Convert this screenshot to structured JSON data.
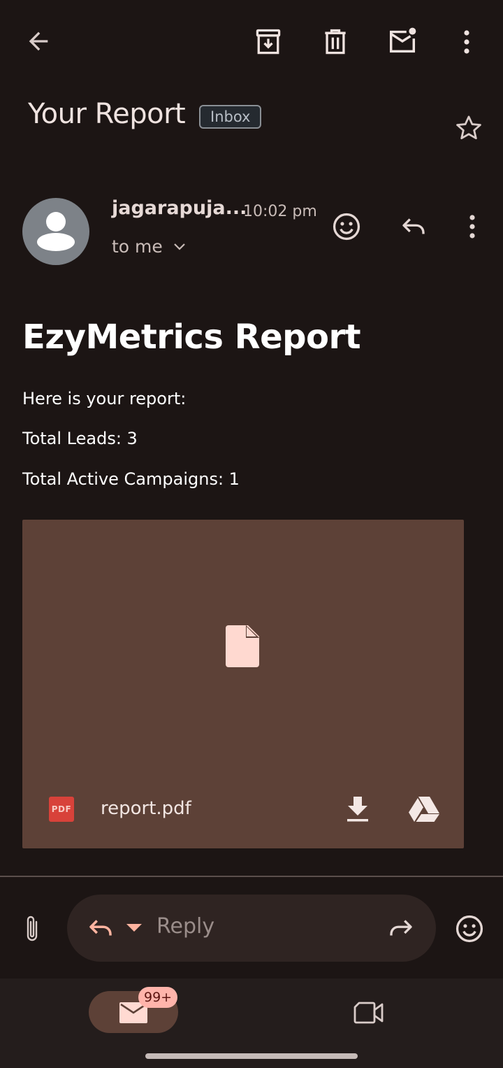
{
  "header": {
    "subject": "Your Report",
    "label_chip": "Inbox"
  },
  "sender": {
    "name": "jagarapuja...",
    "time": "10:02 pm",
    "recipient": "to me"
  },
  "body": {
    "heading": "EzyMetrics Report",
    "lines": [
      "Here is your report:",
      "Total Leads: 3",
      "Total Active Campaigns: 1"
    ]
  },
  "attachment": {
    "type_badge": "PDF",
    "file_name": "report.pdf"
  },
  "reply_bar": {
    "placeholder": "Reply"
  },
  "bottom_nav": {
    "mail_badge": "99+"
  },
  "colors": {
    "background": "#1c1514",
    "attachment_bg": "#5d4137",
    "accent": "#ffb4ab",
    "pdf_red": "#d8423a"
  },
  "icons": {
    "top_bar": [
      "back-arrow-icon",
      "archive-icon",
      "trash-icon",
      "mark-unread-icon",
      "more-vert-icon"
    ],
    "subject_row": [
      "star-icon"
    ],
    "sender_row": [
      "avatar-person-icon",
      "chevron-down-icon",
      "emoji-icon",
      "reply-icon",
      "more-vert-icon"
    ],
    "attachment": [
      "file-icon",
      "download-icon",
      "drive-icon"
    ],
    "reply_bar": [
      "attach-icon",
      "reply-icon",
      "caret-down-icon",
      "forward-icon",
      "emoji-icon"
    ],
    "bottom_nav": [
      "mail-icon",
      "video-icon"
    ]
  }
}
